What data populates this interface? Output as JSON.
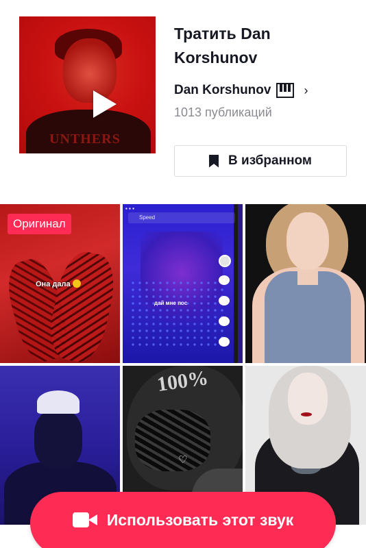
{
  "sound": {
    "title": "Тратить Dan Korshunov",
    "author": "Dan Korshunov",
    "author_icon": "piano-keyboard-icon",
    "posts": "1013 публикаций",
    "cover_shirt_text": "UNTHERS"
  },
  "favorite_button": {
    "label": "В избранном",
    "icon": "bookmark-icon"
  },
  "grid": {
    "original_badge": "Оригинал",
    "tile1_caption": "Она дала",
    "tile2_search": "Speed",
    "tile2_subtitle": "дай мне пос",
    "tile5_helmet_text": "100%"
  },
  "cta": {
    "label": "Использовать этот звук",
    "icon": "video-camera-icon"
  },
  "colors": {
    "accent": "#fe2c55",
    "text": "#161823",
    "muted": "#8a8b91"
  }
}
